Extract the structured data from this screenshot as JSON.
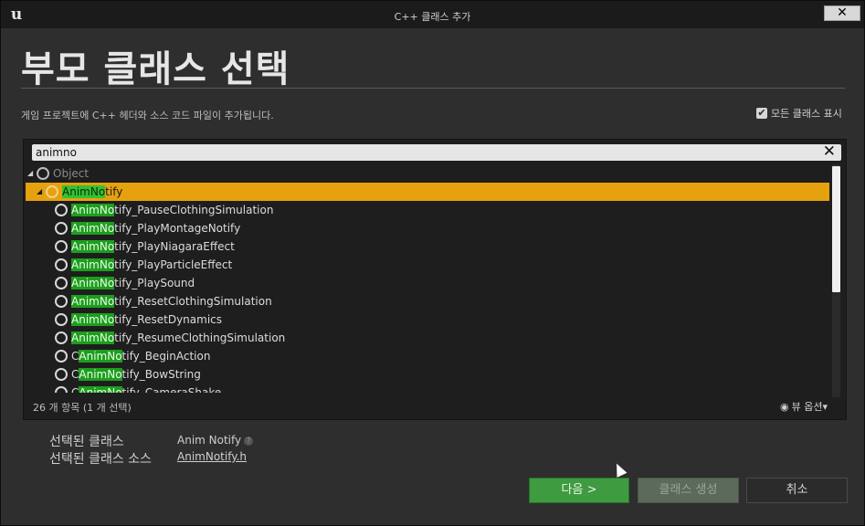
{
  "window": {
    "title": "C++ 클래스 추가",
    "close_icon": "✕",
    "logo_icon": "ue-logo-icon",
    "logo_glyph": "u"
  },
  "header": {
    "title": "부모 클래스 선택",
    "description": "게임 프로젝트에 C++ 헤더와 소스 코드 파일이 추가됩니다.",
    "show_all_label": "모든 클래스 표시",
    "show_all_checked": true
  },
  "search": {
    "value": "animno",
    "clear_icon": "✕"
  },
  "tree": {
    "items": [
      {
        "pre": "",
        "match": "",
        "post": "Object",
        "depth": 0,
        "expanded": true,
        "dim": true
      },
      {
        "pre": "",
        "match": "AnimNo",
        "post": "tify",
        "depth": 1,
        "expanded": true,
        "selected": true
      },
      {
        "pre": "",
        "match": "AnimNo",
        "post": "tify_PauseClothingSimulation",
        "depth": 2
      },
      {
        "pre": "",
        "match": "AnimNo",
        "post": "tify_PlayMontageNotify",
        "depth": 2
      },
      {
        "pre": "",
        "match": "AnimNo",
        "post": "tify_PlayNiagaraEffect",
        "depth": 2
      },
      {
        "pre": "",
        "match": "AnimNo",
        "post": "tify_PlayParticleEffect",
        "depth": 2
      },
      {
        "pre": "",
        "match": "AnimNo",
        "post": "tify_PlaySound",
        "depth": 2
      },
      {
        "pre": "",
        "match": "AnimNo",
        "post": "tify_ResetClothingSimulation",
        "depth": 2
      },
      {
        "pre": "",
        "match": "AnimNo",
        "post": "tify_ResetDynamics",
        "depth": 2
      },
      {
        "pre": "",
        "match": "AnimNo",
        "post": "tify_ResumeClothingSimulation",
        "depth": 2
      },
      {
        "pre": "C",
        "match": "AnimNo",
        "post": "tify_BeginAction",
        "depth": 2
      },
      {
        "pre": "C",
        "match": "AnimNo",
        "post": "tify_BowString",
        "depth": 2
      },
      {
        "pre": "C",
        "match": "AnimNo",
        "post": "tify_CameraShake",
        "depth": 2
      }
    ]
  },
  "footer": {
    "item_count": "26 개 항목 (1 개 선택)",
    "view_options": "뷰 옵션",
    "eye_icon": "◉",
    "dropdown_icon": "▾"
  },
  "selection": {
    "class_label": "선택된 클래스",
    "class_value": "Anim Notify",
    "source_label": "선택된 클래스 소스",
    "source_value": "AnimNotify.h",
    "help_icon": "?"
  },
  "buttons": {
    "next": "다음 >",
    "create": "클래스 생성",
    "cancel": "취소"
  },
  "colors": {
    "selected_row": "#e6a10e",
    "match_highlight": "#1e9d1e",
    "next_button": "#3f9b3f"
  }
}
